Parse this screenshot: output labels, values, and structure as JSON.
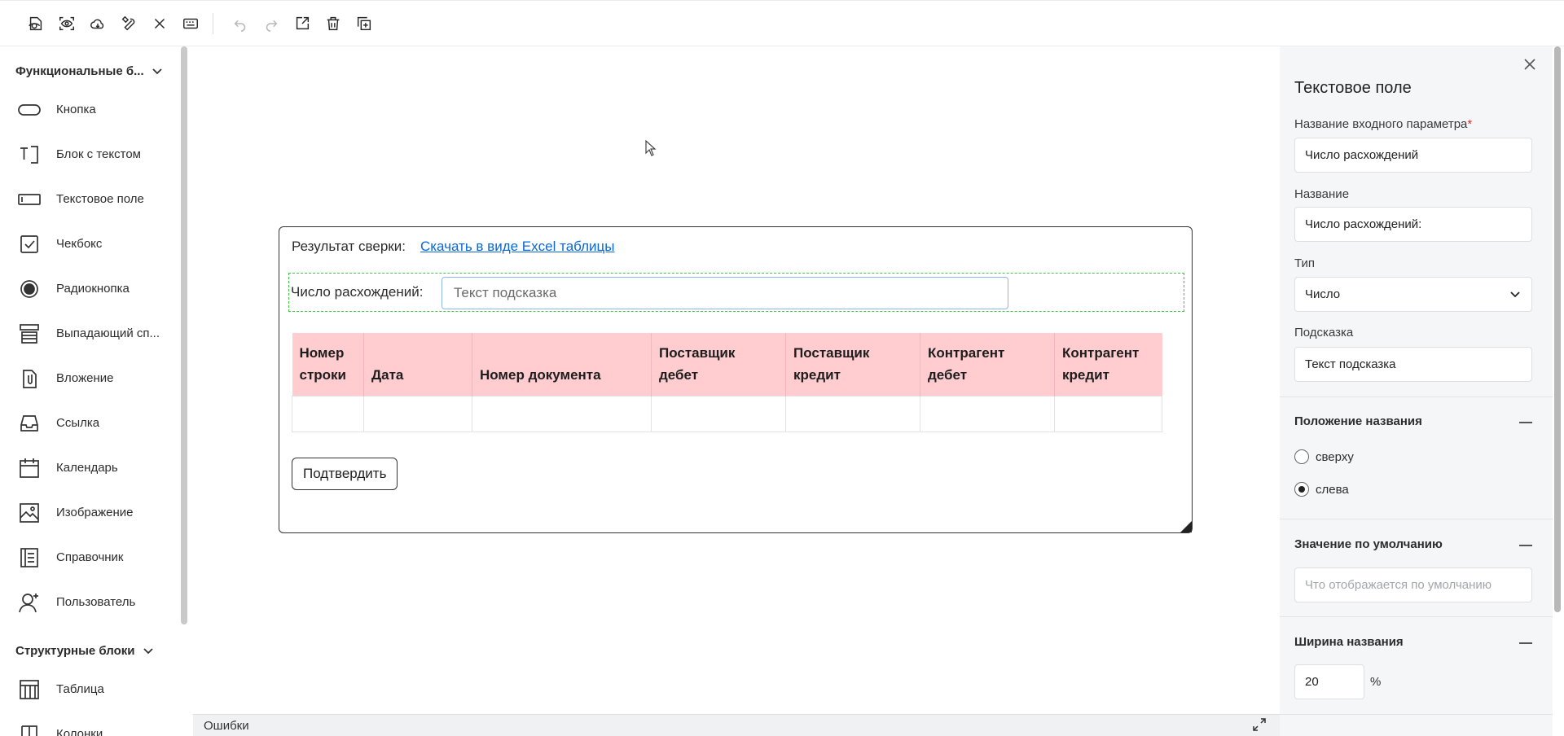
{
  "toolbar": {
    "buttons": [
      {
        "name": "preview-icon"
      },
      {
        "name": "view-icon"
      },
      {
        "name": "cloud-icon"
      },
      {
        "name": "tools-icon"
      },
      {
        "name": "close-icon"
      },
      {
        "name": "keyboard-icon"
      }
    ],
    "history": [
      {
        "name": "undo-icon",
        "enabled": false
      },
      {
        "name": "redo-icon",
        "enabled": false
      },
      {
        "name": "export-icon",
        "enabled": true
      },
      {
        "name": "delete-icon",
        "enabled": true
      },
      {
        "name": "duplicate-icon",
        "enabled": true
      }
    ]
  },
  "palette": {
    "functional_title": "Функциональные б...",
    "functional_items": [
      {
        "label": "Кнопка",
        "icon": "button-icon"
      },
      {
        "label": "Блок с текстом",
        "icon": "text-block-icon"
      },
      {
        "label": "Текстовое поле",
        "icon": "text-field-icon"
      },
      {
        "label": "Чекбокс",
        "icon": "checkbox-icon"
      },
      {
        "label": "Радиокнопка",
        "icon": "radio-icon"
      },
      {
        "label": "Выпадающий сп...",
        "icon": "dropdown-list-icon"
      },
      {
        "label": "Вложение",
        "icon": "attachment-icon"
      },
      {
        "label": "Ссылка",
        "icon": "link-icon"
      },
      {
        "label": "Календарь",
        "icon": "calendar-icon"
      },
      {
        "label": "Изображение",
        "icon": "image-icon"
      },
      {
        "label": "Справочник",
        "icon": "directory-icon"
      },
      {
        "label": "Пользователь",
        "icon": "user-icon"
      }
    ],
    "structural_title": "Структурные блоки",
    "structural_items": [
      {
        "label": "Таблица",
        "icon": "table-icon"
      },
      {
        "label": "Колонки",
        "icon": "columns-icon"
      }
    ]
  },
  "form": {
    "result_label": "Результат сверки:",
    "download_link": "Скачать в виде Excel таблицы",
    "field_label": "Число расхождений:",
    "field_placeholder": "Текст подсказка",
    "table_headers": [
      {
        "l1": "Номер",
        "l2": "строки"
      },
      {
        "l1": "",
        "l2": "Дата"
      },
      {
        "l1": "",
        "l2": "Номер документа"
      },
      {
        "l1": "Поставщик",
        "l2": "дебет"
      },
      {
        "l1": "Поставщик",
        "l2": "кредит"
      },
      {
        "l1": "Контрагент",
        "l2": "дебет"
      },
      {
        "l1": "Контрагент",
        "l2": "кредит"
      }
    ],
    "confirm_label": "Подтвердить"
  },
  "errors_label": "Ошибки",
  "panel": {
    "title": "Текстовое поле",
    "input_param_label": "Название входного параметра",
    "required_mark": "*",
    "input_param_value": "Число расхождений",
    "name_label": "Название",
    "name_value": "Число расхождений:",
    "type_label": "Тип",
    "type_value": "Число",
    "hint_label": "Подсказка",
    "hint_value": "Текст подсказка",
    "position_title": "Положение названия",
    "position_options": [
      {
        "label": "сверху",
        "selected": false
      },
      {
        "label": "слева",
        "selected": true
      }
    ],
    "default_title": "Значение по умолчанию",
    "default_placeholder": "Что отображается по умолчанию",
    "width_title": "Ширина названия",
    "width_value": "20",
    "width_unit": "%"
  }
}
